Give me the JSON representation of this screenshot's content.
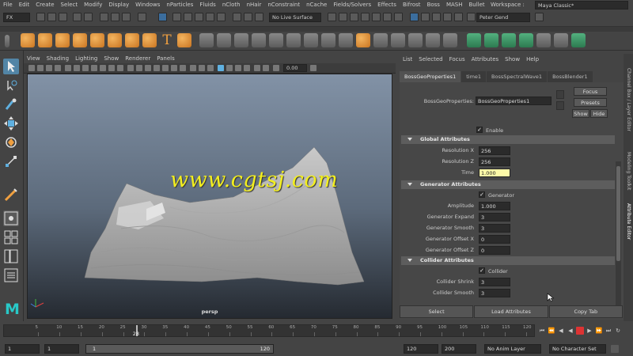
{
  "menubar": {
    "items": [
      "File",
      "Edit",
      "Create",
      "Select",
      "Modify",
      "Display",
      "Windows",
      "nParticles",
      "Fluids",
      "nCloth",
      "nHair",
      "nConstraint",
      "nCache",
      "Fields/Solvers",
      "Effects",
      "Bifrost",
      "Boss",
      "MASH",
      "Bullet"
    ],
    "workspace_label": "Workspace :",
    "workspace_value": "Maya Classic*"
  },
  "statusline": {
    "mode": "FX",
    "live_surface": "No Live Surface",
    "user": "Peter Gend"
  },
  "viewport": {
    "menu": [
      "View",
      "Shading",
      "Lighting",
      "Show",
      "Renderer",
      "Panels"
    ],
    "exposure": "0.00",
    "camera_label": "persp",
    "watermark": "www.cgtsj.com"
  },
  "attribute_editor": {
    "menu": [
      "List",
      "Selected",
      "Focus",
      "Attributes",
      "Show",
      "Help"
    ],
    "tabs": [
      "BossGeoProperties1",
      "time1",
      "BossSpectralWave1",
      "BossBlender1"
    ],
    "node_label": "BossGeoProperties:",
    "node_name": "BossGeoProperties1",
    "focus_btn": "Focus",
    "presets_btn": "Presets",
    "show_btn": "Show",
    "hide_btn": "Hide",
    "enable_label": "Enable",
    "global": {
      "title": "Global Attributes",
      "resolution_x_label": "Resolution X",
      "resolution_x": "256",
      "resolution_z_label": "Resolution Z",
      "resolution_z": "256",
      "time_label": "Time",
      "time": "1.000"
    },
    "generator": {
      "title": "Generator Attributes",
      "toggle_label": "Generator",
      "amplitude_label": "Amplitude",
      "amplitude": "1.000",
      "expand_label": "Generator Expand",
      "expand": "3",
      "smooth_label": "Generator Smooth",
      "smooth": "3",
      "offset_x_label": "Generator Offset X",
      "offset_x": "0",
      "offset_z_label": "Generator Offset Z",
      "offset_z": "0"
    },
    "collider": {
      "title": "Collider Attributes",
      "toggle_label": "Collider",
      "shrink_label": "Collider Shrink",
      "shrink": "3",
      "smooth_label": "Collider Smooth",
      "smooth": "3"
    },
    "bottom": {
      "select": "Select",
      "load": "Load Attributes",
      "copy": "Copy Tab"
    }
  },
  "side_tabs": [
    "Channel Box / Layer Editor",
    "Modeling Toolkit",
    "Attribute Editor"
  ],
  "timeline": {
    "ticks": [
      "5",
      "10",
      "15",
      "20",
      "25",
      "30",
      "35",
      "40",
      "45",
      "50",
      "55",
      "60",
      "65",
      "70",
      "75",
      "80",
      "85",
      "90",
      "95",
      "100",
      "105",
      "110",
      "115",
      "120"
    ],
    "current_frame": "28"
  },
  "range": {
    "start": "1",
    "playback_start": "1",
    "slider_start": "1",
    "slider_end": "120",
    "playback_end": "120",
    "end": "200",
    "anim_layer": "No Anim Layer",
    "char_set": "No Character Set"
  }
}
